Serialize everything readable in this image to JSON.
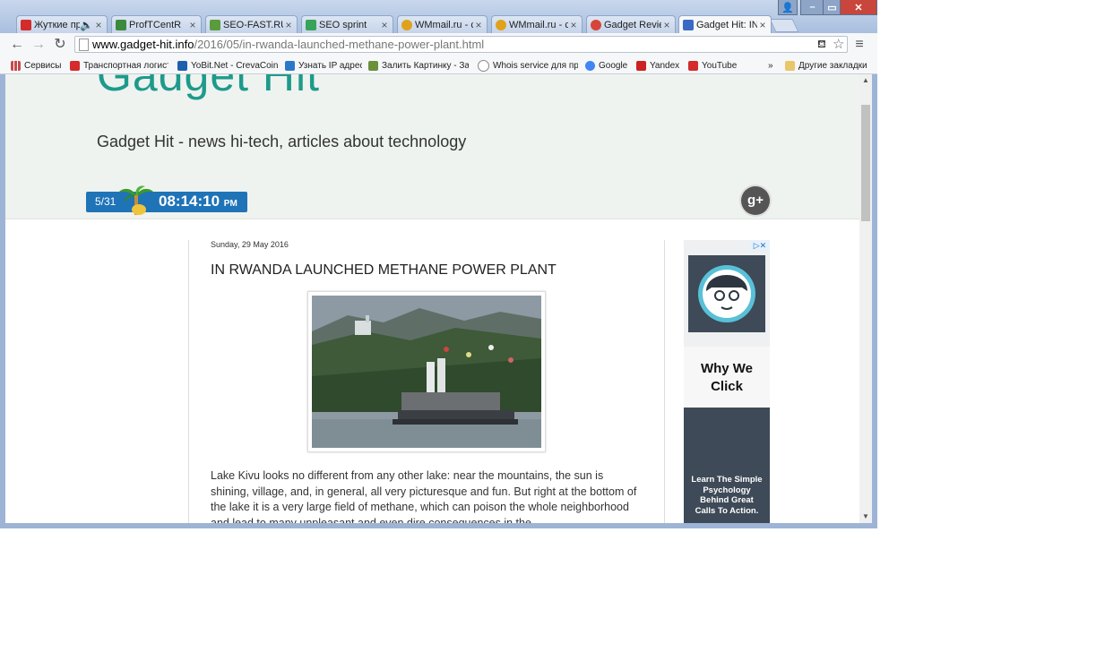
{
  "browser": {
    "tabs": [
      {
        "label": "Жуткие пр",
        "color": "#d42b2b"
      },
      {
        "label": "ProfTCentR",
        "color": "#3d8a3d"
      },
      {
        "label": "SEO-FAST.RU",
        "color": "#5a9c3c"
      },
      {
        "label": "SEO sprint",
        "color": "#3aa35a"
      },
      {
        "label": "WMmail.ru - c",
        "color": "#e0a21c"
      },
      {
        "label": "WMmail.ru - c",
        "color": "#e0a21c"
      },
      {
        "label": "Gadget Review",
        "color": "#d64537"
      },
      {
        "label": "Gadget Hit: IN",
        "color": "#3a6ac4"
      }
    ],
    "address": {
      "domain": "www.gadget-hit.info",
      "path": "/2016/05/in-rwanda-launched-methane-power-plant.html"
    },
    "bookmarks": [
      {
        "label": "Сервисы",
        "color": "#c64a4a"
      },
      {
        "label": "Транспортная логист",
        "color": "#d42b2b"
      },
      {
        "label": "YoBit.Net - CrevaCoin",
        "color": "#1f5fae"
      },
      {
        "label": "Узнать IP адрес",
        "color": "#2a79c9"
      },
      {
        "label": "Залить Картинку - За",
        "color": "#6b8f3b"
      },
      {
        "label": "Whois service для про",
        "color": "#888888"
      },
      {
        "label": "Google",
        "color": "#4285f4"
      },
      {
        "label": "Yandex",
        "color": "#cc2222"
      },
      {
        "label": "YouTube",
        "color": "#d42b2b"
      }
    ],
    "bookmarks_more": "»",
    "other_bookmarks": "Другие закладки"
  },
  "site": {
    "logo": "Gadget Hit",
    "tagline": "Gadget Hit - news hi-tech, articles about technology",
    "clock_date": "5/31",
    "clock_time": "08:14:10",
    "clock_ampm": "PM",
    "gplus_label": "g+"
  },
  "post": {
    "date": "Sunday, 29 May 2016",
    "title": "IN RWANDA LAUNCHED METHANE POWER PLANT",
    "body": "Lake Kivu looks no different from any other lake: near the mountains, the sun is shining, village, and, in general, all very picturesque and fun. But right at the bottom of the lake it is a very large field of methane, which can poison the whole neighborhood and lead to many unpleasant and even dire consequences in the"
  },
  "ad": {
    "choices": "▷✕",
    "headline": "Why We Click",
    "text": "Learn The Simple Psychology Behind Great Calls To Action."
  },
  "colors": {
    "accent": "#1e9a8c",
    "clock_bg": "#1f73b7",
    "chrome_frame": "#9db4d6"
  }
}
